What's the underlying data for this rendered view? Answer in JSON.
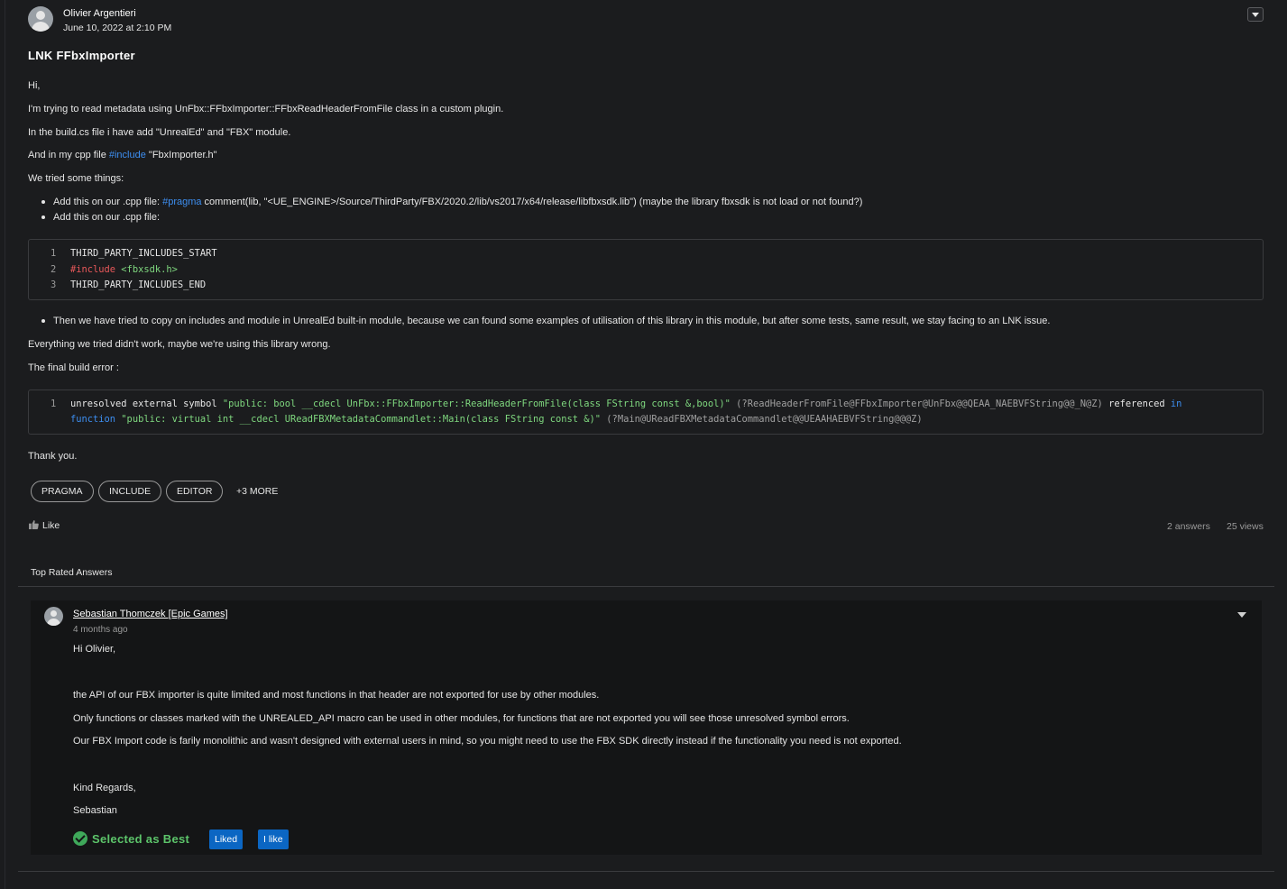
{
  "post": {
    "author": "Olivier Argentieri",
    "date": "June 10, 2022 at 2:10 PM",
    "title": "LNK FFbxImporter",
    "greeting": "Hi,",
    "line1": "I'm trying to read metadata using UnFbx::FFbxImporter::FFbxReadHeaderFromFile class in a custom plugin.",
    "line2": "In the build.cs file i have add \"UnrealEd\" and \"FBX\" module.",
    "line3_pre": "And in my cpp file ",
    "line3_link": "#include",
    "line3_post": " \"FbxImporter.h\"",
    "tried": "We tried some things:",
    "bullet1_pre": "Add this on our .cpp file: ",
    "bullet1_link": "#pragma",
    "bullet1_post": " comment(lib, \"<UE_ENGINE>/Source/ThirdParty/FBX/2020.2/lib/vs2017/x64/release/libfbxsdk.lib\") (maybe the library fbxsdk is not load or not found?)",
    "bullet2": "Add this on our .cpp file:",
    "code1": {
      "nums": [
        "1",
        "2",
        "3"
      ],
      "line1": "THIRD_PARTY_INCLUDES_START",
      "line2_kw": "#include",
      "line2_rest": " <fbxsdk.h>",
      "line3": "THIRD_PARTY_INCLUDES_END"
    },
    "bullet3": "Then we have tried to copy on includes and module in UnrealEd built-in module, because we can found some examples of utilisation of this library in this module, but after some tests, same result, we stay facing to an LNK issue.",
    "everything": "Everything we tried didn't work, maybe we're using this library wrong.",
    "final": "The final build error :",
    "code2": {
      "num": "1",
      "a1": "unresolved external symbol ",
      "a2": "\"public: bool __cdecl UnFbx::FFbxImporter::ReadHeaderFromFile(class FString const &,bool)\"",
      "a3": " (?ReadHeaderFromFile@FFbxImporter@UnFbx@@QEAA_NAEBVFString@@_N@Z)",
      "a4": " referenced ",
      "a5": "in",
      "b1": "function",
      "b2": " \"public: virtual int __cdecl UReadFBXMetadataCommandlet::Main(class FString const &)\"",
      "b3": " (?Main@UReadFBXMetadataCommandlet@@UEAAHAEBVFString@@@Z)"
    },
    "thanks": "Thank you.",
    "tags": [
      "PRAGMA",
      "INCLUDE",
      "EDITOR"
    ],
    "more": "+3 MORE",
    "like": "Like",
    "answers_count": "2 answers",
    "views_count": "25 views"
  },
  "answers_section": {
    "title": "Top Rated Answers",
    "answer": {
      "author": "Sebastian Thomczek [Epic Games]",
      "time": "4 months ago",
      "p1": "Hi Olivier,",
      "p2": "the API of our FBX importer is quite limited and most functions in that header are not exported for use by other modules.",
      "p3": "Only functions or classes marked with the UNREALED_API macro can be used in other modules, for functions that are not exported you will see those unresolved symbol errors.",
      "p4": "Our FBX Import code is farily monolithic and wasn't designed with external users in mind, so you might need to use the FBX SDK directly instead if the functionality you need is not exported.",
      "p5": "Kind Regards,",
      "p6": "Sebastian",
      "best": "Selected as Best",
      "liked": "Liked",
      "ilike": "I like"
    }
  },
  "icons": [
    "user-avatar-icon",
    "chevron-down-icon",
    "thumb-up-icon",
    "check-circle-icon"
  ],
  "colors": {
    "link": "#3d8ef0",
    "accent_green": "#5cc46a",
    "button_blue": "#0b66c3",
    "background": "#1b1c1e"
  }
}
